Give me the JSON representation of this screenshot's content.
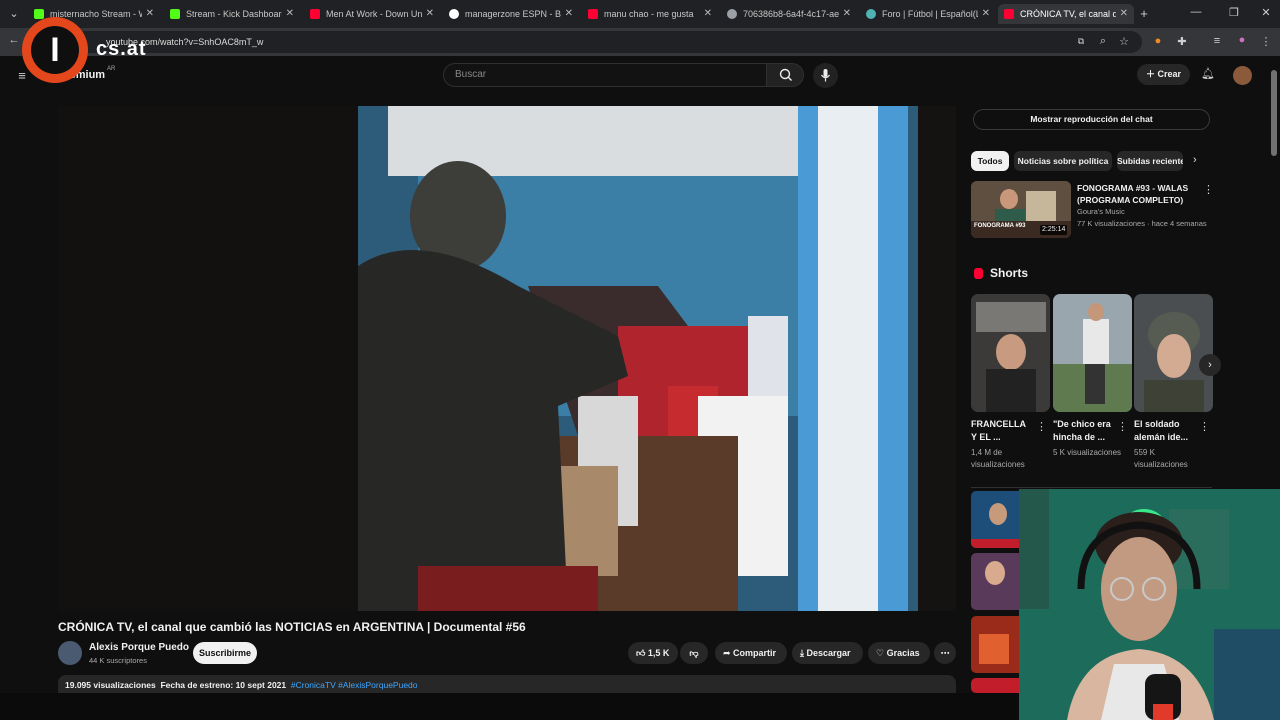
{
  "browser": {
    "tabs": [
      {
        "title": "misternacho Stream - Watch",
        "color": "#53fc18",
        "active": false
      },
      {
        "title": "Stream - Kick Dashboard",
        "color": "#53fc18",
        "active": false
      },
      {
        "title": "Men At Work - Down Under",
        "color": "#ff0033",
        "active": false
      },
      {
        "title": "managerzone ESPN - Buscar",
        "color": "#ffffff",
        "active": false
      },
      {
        "title": "manu chao - me gusta",
        "color": "#ff0033",
        "active": false
      },
      {
        "title": "706386b8-6a4f-4c17-aefb",
        "color": "#9aa0a6",
        "active": false
      },
      {
        "title": "Foro | Fútbol | Español(La",
        "color": "#4fb3b3",
        "active": false
      },
      {
        "title": "CRÓNICA TV, el canal q",
        "color": "#ff0033",
        "active": true
      }
    ],
    "url": "youtube.com/watch?v=SnhOAC8mT_w"
  },
  "logo": {
    "letter": "I",
    "text": "cs.at",
    "premium": "Premium",
    "region": "AR"
  },
  "header": {
    "search_placeholder": "Buscar",
    "create_label": "Crear"
  },
  "video": {
    "title": "CRÓNICA TV, el canal que cambió las NOTICIAS en ARGENTINA | Documental #56",
    "channel": "Alexis Porque Puedo",
    "subscribers": "44 K suscriptores",
    "subscribe_label": "Suscribirme",
    "likes": "1,5 K",
    "share_label": "Compartir",
    "download_label": "Descargar",
    "thanks_label": "Gracias",
    "views": "19.095 visualizaciones",
    "premiere": "Fecha de estreno: 10 sept 2021",
    "hashtags": "#CronicaTV #AlexisPorquePuedo"
  },
  "sidebar": {
    "chat_button": "Mostrar reproducción del chat",
    "chips": [
      "Todos",
      "Noticias sobre política",
      "Subidas recientes"
    ],
    "recommendation": {
      "title": "FONOGRAMA #93 - WALAS (PROGRAMA COMPLETO)",
      "channel": "Goura's Music",
      "meta": "77 K visualizaciones · hace 4 semanas",
      "duration": "2:25:14",
      "thumb_label": "FONOGRAMA #93"
    },
    "shorts_heading": "Shorts",
    "shorts": [
      {
        "title": "FRANCELLA Y EL ...",
        "views": "1,4 M de visualizaciones"
      },
      {
        "title": "\"De chico era hincha de ...",
        "views": "5 K visualizaciones"
      },
      {
        "title": "El soldado alemán ide...",
        "views": "559 K visualizaciones"
      }
    ]
  }
}
